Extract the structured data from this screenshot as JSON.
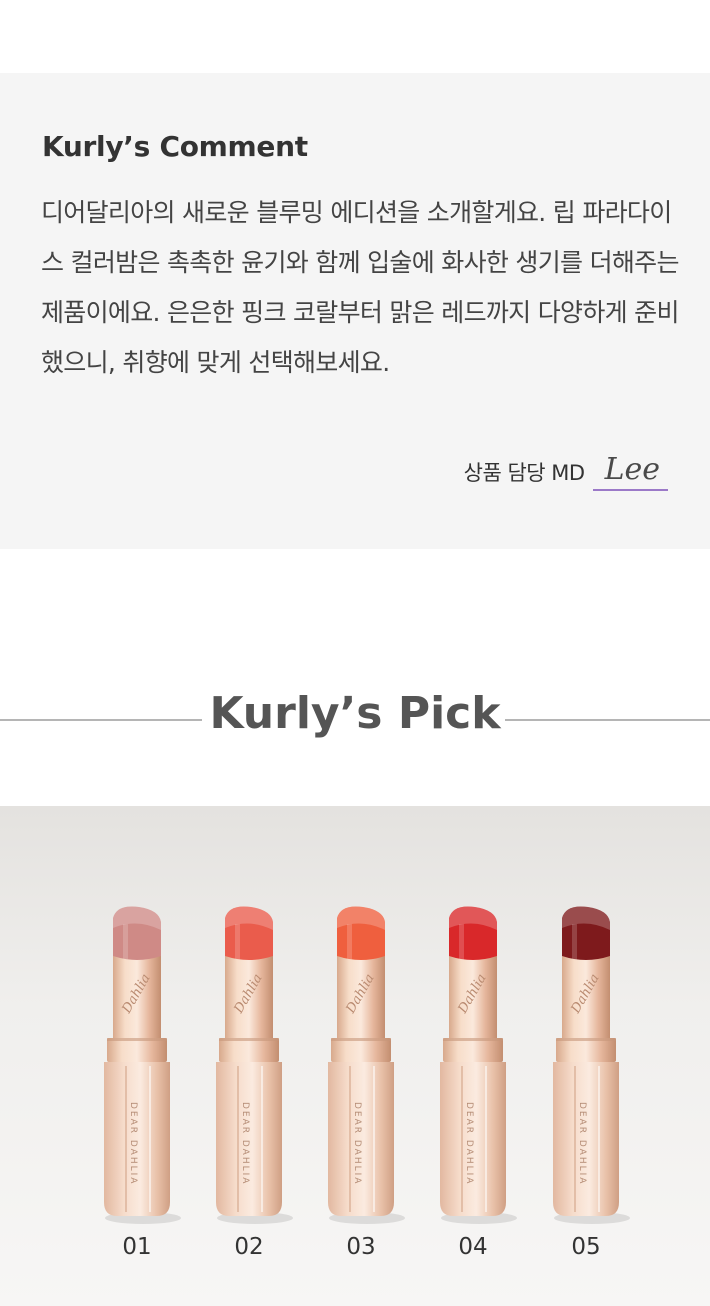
{
  "comment": {
    "title": "Kurly’s Comment",
    "body": "디어달리아의 새로운 블루밍 에디션을 소개할게요. 립 파라다이스 컬러밤은 촉촉한 윤기와 함께 입술에 화사한 생기를 더해주는 제품이에요. 은은한 핑크 코랄부터 맑은 레드까지 다양하게 준비했으니, 취향에 맞게 선택해보세요.",
    "signature_role": "상품 담당 MD",
    "signature_name": "Lee"
  },
  "pick": {
    "title": "Kurly’s Pick"
  },
  "product_photo": {
    "brand_text": "DEAR DAHLIA",
    "script_text": "Dahlia",
    "shades": [
      {
        "label": "01",
        "color": "#cf8a86"
      },
      {
        "label": "02",
        "color": "#ea5c4c"
      },
      {
        "label": "03",
        "color": "#ef5f3e"
      },
      {
        "label": "04",
        "color": "#d9282a"
      },
      {
        "label": "05",
        "color": "#7e1a1c"
      }
    ]
  }
}
